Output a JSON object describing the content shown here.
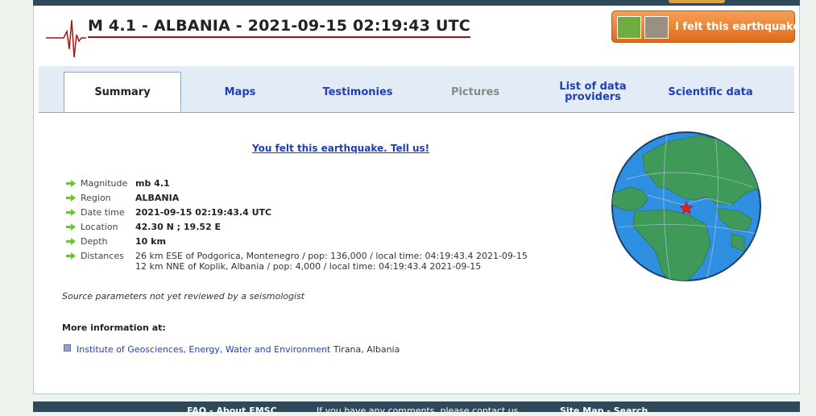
{
  "header": {
    "title": "M 4.1 - ALBANIA - 2021-09-15 02:19:43 UTC",
    "felt_button": "I felt this earthquake"
  },
  "tabs": [
    {
      "label": "Summary",
      "state": "active"
    },
    {
      "label": "Maps",
      "state": "normal"
    },
    {
      "label": "Testimonies",
      "state": "normal"
    },
    {
      "label": "Pictures",
      "state": "disabled"
    },
    {
      "label": "List of data providers",
      "state": "normal"
    },
    {
      "label": "Scientific data",
      "state": "normal"
    }
  ],
  "felt_link": "You felt this earthquake. Tell us!",
  "params": {
    "magnitude": {
      "label": "Magnitude",
      "value": "mb 4.1"
    },
    "region": {
      "label": "Region",
      "value": "ALBANIA"
    },
    "datetime": {
      "label": "Date time",
      "value": "2021-09-15 02:19:43.4 UTC"
    },
    "location": {
      "label": "Location",
      "value": "42.30 N ; 19.52 E"
    },
    "depth": {
      "label": "Depth",
      "value": "10 km"
    },
    "distances": {
      "label": "Distances",
      "lines": [
        "26 km ESE of Podgorica, Montenegro / pop: 136,000 / local time: 04:19:43.4 2021-09-15",
        "12 km NNE of Koplik, Albania / pop: 4,000 / local time: 04:19:43.4 2021-09-15"
      ]
    }
  },
  "review_note": "Source parameters not yet reviewed by a seismologist",
  "more_info": {
    "heading": "More information at:",
    "source_name": "Institute of Geosciences, Energy, Water and Environment",
    "source_place": "Tirana, Albania"
  },
  "footer": {
    "left": "FAQ - About EMSC",
    "middle": "If you have any comments, please contact us",
    "right": "Site Map - Search"
  },
  "colors": {
    "link": "#1f3fb8",
    "ocean": "#2f8fe0",
    "land": "#3f9a5a",
    "epicenter": "#e02020",
    "button": "#e06a1c"
  }
}
